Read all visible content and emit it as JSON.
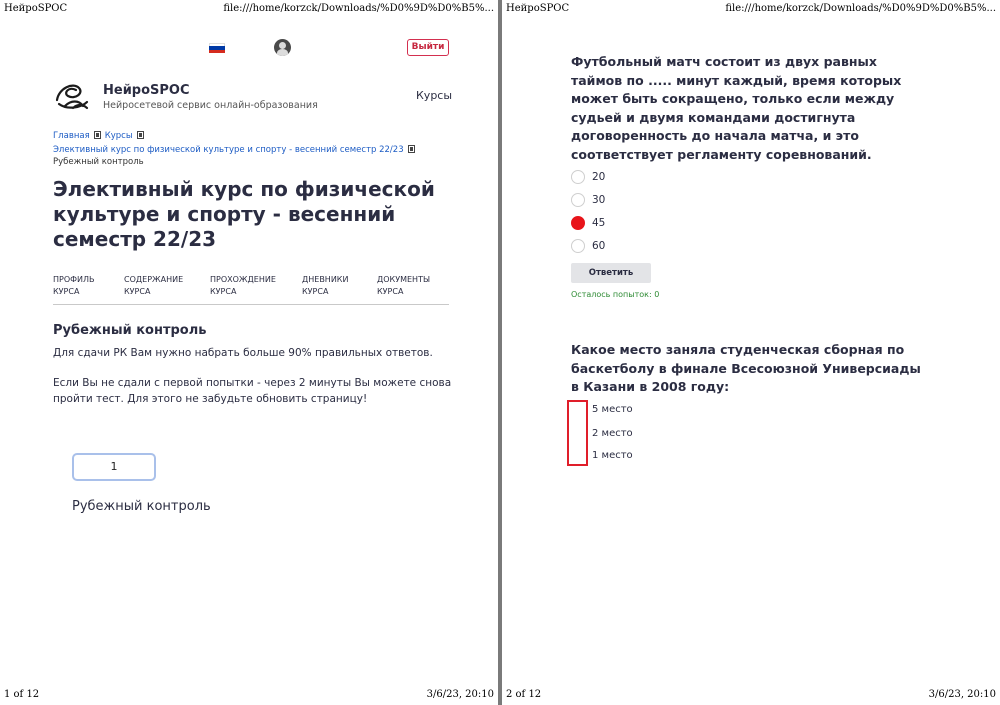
{
  "print_header": {
    "site": "НейроSPOC",
    "url": "file:///home/korzck/Downloads/%D0%9D%D0%B5%..."
  },
  "pages": [
    {
      "footer_left": "1 of 12",
      "footer_right": "3/6/23, 20:10"
    },
    {
      "footer_left": "2 of 12",
      "footer_right": "3/6/23, 20:10"
    }
  ],
  "topbar": {
    "logout_label": "Выйти",
    "flag_colors": [
      "#ffffff",
      "#0039a6",
      "#d52b1e"
    ]
  },
  "brand": {
    "name": "НейроSPOC",
    "tagline": "Нейросетевой сервис онлайн-образования"
  },
  "nav": {
    "courses": "Курсы"
  },
  "breadcrumb": {
    "home": "Главная",
    "courses": "Курсы",
    "course": "Элективный курс по физической культуре и спорту - весенний семестр 22/23",
    "current": "Рубежный контроль"
  },
  "course_title": "Элективный курс по физической культуре и спорту - весенний семестр 22/23",
  "tabs": [
    {
      "line1": "ПРОФИЛЬ",
      "line2": "КУРСА"
    },
    {
      "line1": "СОДЕРЖАНИЕ",
      "line2": "КУРСА"
    },
    {
      "line1": "ПРОХОЖДЕНИЕ",
      "line2": "КУРСА"
    },
    {
      "line1": "ДНЕВНИКИ",
      "line2": "КУРСА"
    },
    {
      "line1": "ДОКУМЕНТЫ",
      "line2": "КУРСА"
    }
  ],
  "section": {
    "title": "Рубежный контроль",
    "p1": "Для сдачи РК Вам нужно набрать больше 90% правильных ответов.",
    "p2": "Если Вы не сдали с первой попытки - через 2 минуты Вы можете снова пройти тест. Для этого не забудьте обновить страницу!"
  },
  "attempt": {
    "number": "1",
    "title": "Рубежный контроль"
  },
  "question1": {
    "text": "Футбольный матч состоит из двух равных таймов по .....  минут каждый, время которых может быть сокращено, только если между судьей и двумя командами достигнута договоренность до начала матча, и это соответствует регламенту соревнований.",
    "options": [
      "20",
      "30",
      "45",
      "60"
    ],
    "selected_index": 2,
    "submit_label": "Ответить",
    "attempts_left": "Осталось попыток: 0"
  },
  "question2": {
    "text": "Какое место заняла студенческая сборная по баскетболу в финале Всесоюзной Универсиады в Казани в 2008 году:",
    "options": [
      "5 место",
      "2 место",
      "1 место"
    ]
  },
  "colors": {
    "accent_red": "#e8141a",
    "logout": "#c62840",
    "link": "#1d5cc4",
    "text": "#2b2d42",
    "success": "#2e8b34"
  }
}
